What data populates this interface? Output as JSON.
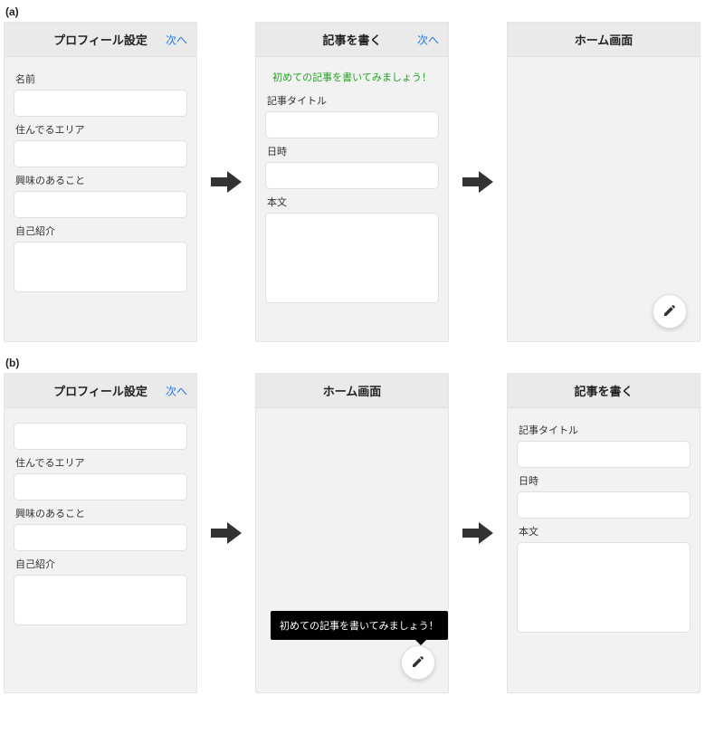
{
  "rowA": {
    "label": "(a)",
    "screens": {
      "profile": {
        "title": "プロフィール設定",
        "next": "次へ",
        "fields": {
          "name": "名前",
          "area": "住んでるエリア",
          "interests": "興味のあること",
          "bio": "自己紹介"
        }
      },
      "write": {
        "title": "記事を書く",
        "next": "次へ",
        "hint": "初めての記事を書いてみましょう！",
        "fields": {
          "articleTitle": "記事タイトル",
          "datetime": "日時",
          "body": "本文"
        }
      },
      "home": {
        "title": "ホーム画面"
      }
    }
  },
  "rowB": {
    "label": "(b)",
    "screens": {
      "profile": {
        "title": "プロフィール設定",
        "next": "次へ",
        "fields": {
          "name": "",
          "area": "住んでるエリア",
          "interests": "興味のあること",
          "bio": "自己紹介"
        }
      },
      "home": {
        "title": "ホーム画面",
        "tooltip": "初めての記事を書いてみましょう！"
      },
      "write": {
        "title": "記事を書く",
        "fields": {
          "articleTitle": "記事タイトル",
          "datetime": "日時",
          "body": "本文"
        }
      }
    }
  }
}
